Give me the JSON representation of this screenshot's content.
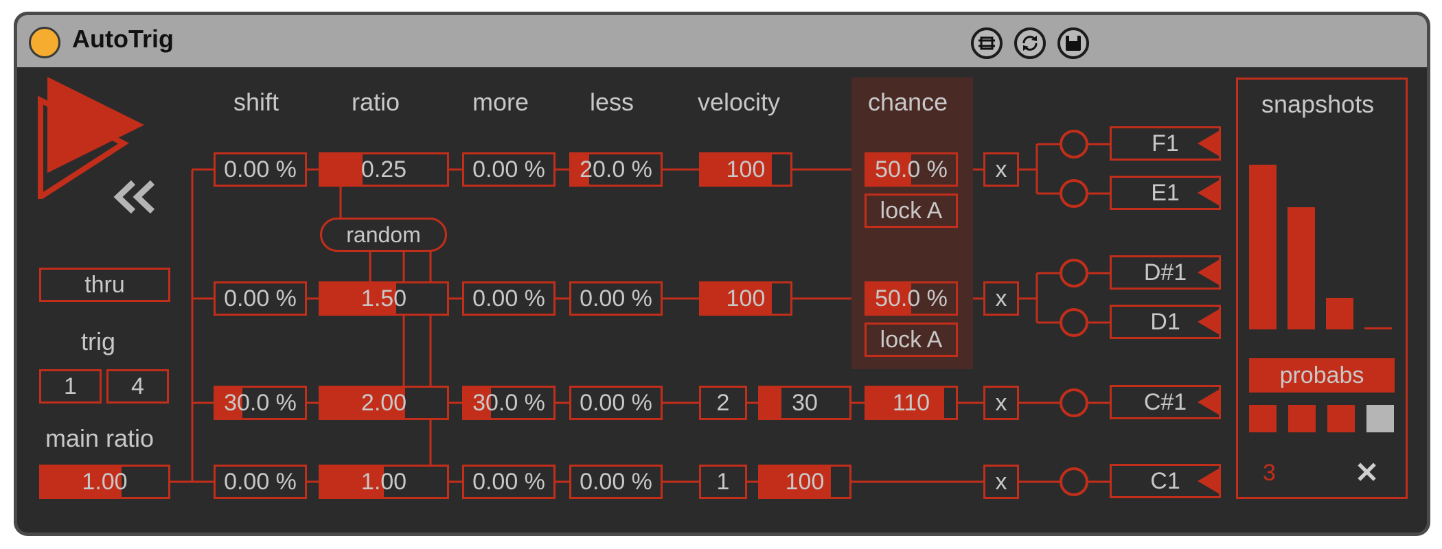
{
  "device": {
    "title": "AutoTrig"
  },
  "headers": {
    "shift": "shift",
    "ratio": "ratio",
    "more": "more",
    "less": "less",
    "velocity": "velocity",
    "chance": "chance",
    "snapshots": "snapshots"
  },
  "left": {
    "mode": "thru",
    "trig_label": "trig",
    "trig_a": "1",
    "trig_b": "4",
    "main_ratio_label": "main ratio",
    "main_ratio": "1.00",
    "main_ratio_fill": 0.63
  },
  "random_label": "random",
  "rows": [
    {
      "shift": "0.00 %",
      "shift_fill": 0.0,
      "ratio": "0.25",
      "ratio_fill": 0.33,
      "more": "0.00 %",
      "more_fill": 0.0,
      "less": "20.0 %",
      "less_fill": 0.2,
      "velocity": "100",
      "velocity_fill": 0.79,
      "chance": "50.0 %",
      "chance_fill": 0.5,
      "lock": "lock A",
      "x": "x",
      "notes": [
        "F1",
        "E1"
      ]
    },
    {
      "shift": "0.00 %",
      "shift_fill": 0.0,
      "ratio": "1.50",
      "ratio_fill": 0.6,
      "more": "0.00 %",
      "more_fill": 0.0,
      "less": "0.00 %",
      "less_fill": 0.0,
      "velocity": "100",
      "velocity_fill": 0.79,
      "chance": "50.0 %",
      "chance_fill": 0.5,
      "lock": "lock A",
      "x": "x",
      "notes": [
        "D#1",
        "D1"
      ]
    },
    {
      "shift": "30.0 %",
      "shift_fill": 0.3,
      "ratio": "2.00",
      "ratio_fill": 0.67,
      "more": "30.0 %",
      "more_fill": 0.3,
      "less": "0.00 %",
      "less_fill": 0.0,
      "vel_min": "2",
      "vel_range": "30",
      "vel_range_fill": 0.24,
      "vel_val": "110",
      "vel_val_fill": 0.87,
      "x": "x",
      "notes": [
        "C#1"
      ]
    },
    {
      "shift": "0.00 %",
      "shift_fill": 0.0,
      "ratio": "1.00",
      "ratio_fill": 0.5,
      "more": "0.00 %",
      "more_fill": 0.0,
      "less": "0.00 %",
      "less_fill": 0.0,
      "vel_min": "1",
      "vel_range": "100",
      "vel_range_fill": 0.79,
      "x": "x",
      "notes": [
        "C1"
      ]
    }
  ],
  "snapshots": {
    "histogram": [
      1.0,
      0.74,
      0.19,
      0.0
    ],
    "mode": "probabs",
    "selector_count": 4,
    "selected": 3,
    "count": "3",
    "clear": "✕"
  },
  "colors": {
    "accent": "#c32e1a",
    "background": "#2b2b2b",
    "text": "#c8c8c8",
    "titlebar": "#a6a6a6",
    "power": "#f6ad2f"
  },
  "icons": {
    "power": "power-icon",
    "play": "play-icon",
    "rewind": "rewind-icon",
    "pin": "pin-icon",
    "refresh": "refresh-icon",
    "save": "save-icon",
    "clear": "close-icon"
  }
}
